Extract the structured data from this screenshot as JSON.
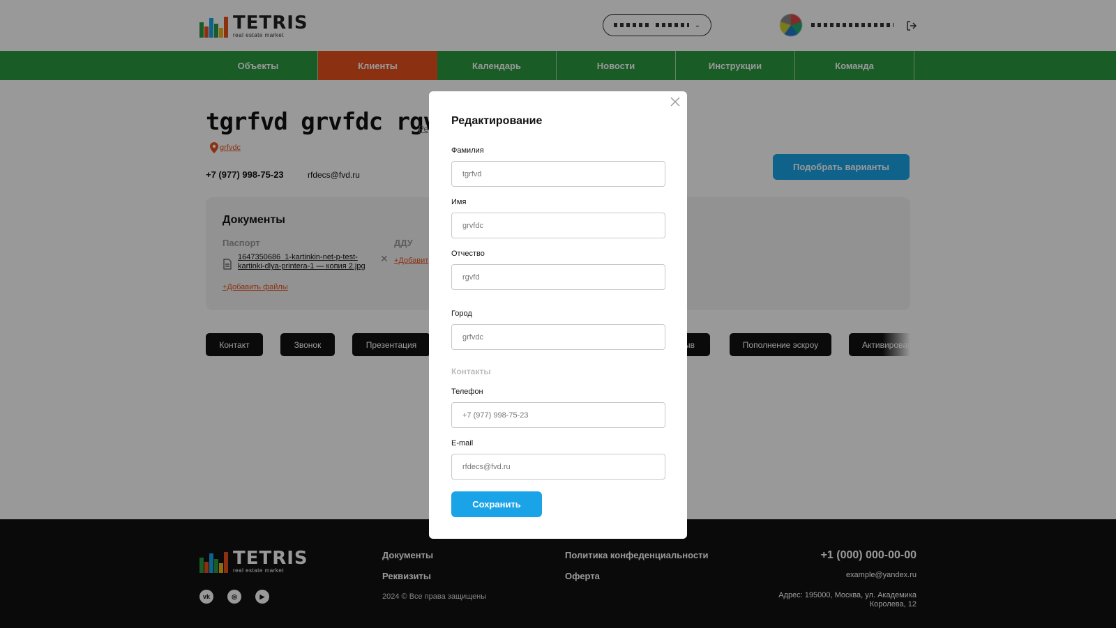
{
  "brand": {
    "name": "TETRIS",
    "tagline": "real estate market"
  },
  "nav": {
    "items": [
      {
        "label": "Объекты"
      },
      {
        "label": "Клиенты"
      },
      {
        "label": "Календарь"
      },
      {
        "label": "Новости"
      },
      {
        "label": "Инструкции"
      },
      {
        "label": "Команда"
      }
    ],
    "active_index": 1
  },
  "client": {
    "title": "tgrfvd grvfdc rgvfd",
    "edit_link": "Ре",
    "city": "grfvdc",
    "phone": "+7 (977) 998-75-23",
    "email": "rfdecs@fvd.ru",
    "pick_button": "Подобрать варианты"
  },
  "documents": {
    "title": "Документы",
    "passport_label": "Паспорт",
    "passport_file": "1647350686_1-kartinkin-net-p-test-kartinki-dlya-printera-1 — копия 2.jpg",
    "add_files": "+Добавить файлы",
    "ddu_label": "ДДУ",
    "ddu_add": "+Добавит"
  },
  "actions": [
    {
      "label": "Контакт"
    },
    {
      "label": "Звонок"
    },
    {
      "label": "Презентация"
    },
    {
      "label": "ыв"
    },
    {
      "label": "Пополнение эскроу"
    },
    {
      "label": "Активирован"
    }
  ],
  "modal": {
    "title": "Редактирование",
    "surname_label": "Фамилия",
    "surname_value": "tgrfvd",
    "name_label": "Имя",
    "name_value": "grvfdc",
    "patronymic_label": "Отчество",
    "patronymic_value": "rgvfd",
    "city_label": "Город",
    "city_value": "grfvdc",
    "contacts_section": "Контакты",
    "phone_label": "Телефон",
    "phone_value": "+7 (977) 998-75-23",
    "email_label": "E-mail",
    "email_value": "rfdecs@fvd.ru",
    "save_button": "Сохранить"
  },
  "footer": {
    "documents_link": "Документы",
    "requisites_link": "Реквизиты",
    "copyright": "2024 © Все права защищены",
    "privacy_link": "Политика конфеденциальности",
    "offer_link": "Оферта",
    "phone": "+1 (000) 000-00-00",
    "email": "example@yandex.ru",
    "address": "Адрес: 195000, Москва, ул. Академика Королева, 12",
    "socials": [
      {
        "icon": "vk-icon",
        "glyph": "vk"
      },
      {
        "icon": "instagram-icon",
        "glyph": "◎"
      },
      {
        "icon": "youtube-icon",
        "glyph": "▶"
      }
    ]
  },
  "colors": {
    "accent_green": "#2b9a3f",
    "accent_orange": "#e8531f",
    "accent_blue": "#1aa3e6"
  }
}
